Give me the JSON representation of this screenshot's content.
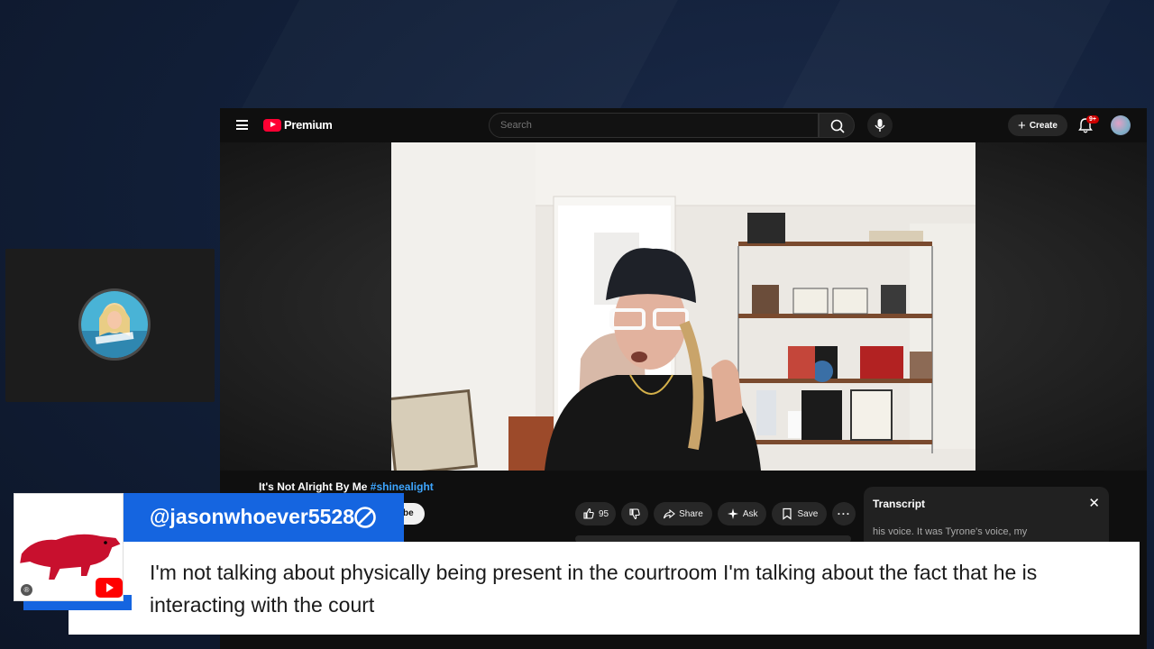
{
  "youtube": {
    "logo_text": "Premium",
    "search_placeholder": "Search",
    "create_label": "Create",
    "notification_badge": "9+",
    "video_title": "It's Not Alright By Me",
    "video_hashtag": "#shinealight",
    "subscribe_partial": "be",
    "like_count": "95",
    "share_label": "Share",
    "ask_label": "Ask",
    "save_label": "Save",
    "transcript": {
      "title": "Transcript",
      "line": "his voice. It was Tyrone's voice, my"
    }
  },
  "overlay": {
    "username": "@jasonwhoever5528",
    "comment": "I'm not talking about physically being present in the courtroom I'm talking about the fact that he is interacting with the court"
  },
  "colors": {
    "name_bar": "#1565e0",
    "youtube_red": "#ff0033",
    "razorback_red": "#c8102e"
  }
}
